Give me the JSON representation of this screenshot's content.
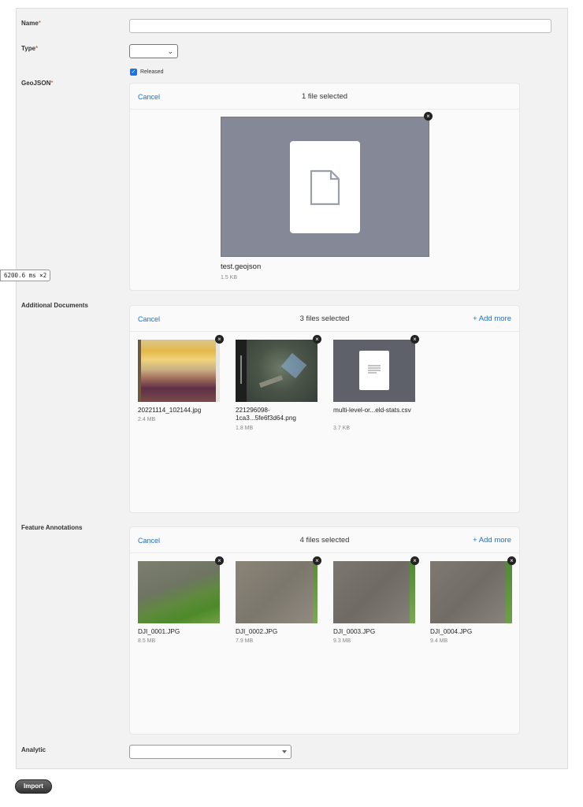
{
  "form": {
    "name": {
      "label": "Name",
      "required_mark": "*",
      "value": ""
    },
    "type": {
      "label": "Type",
      "required_mark": "*",
      "selected": ""
    },
    "released": {
      "label": "Released",
      "checked": true
    },
    "geojson": {
      "label": "GeoJSON",
      "required_mark": "*",
      "cancel": "Cancel",
      "status": "1 file selected",
      "files": [
        {
          "name": "test.geojson",
          "size": "1.5 KB",
          "kind": "document"
        }
      ]
    },
    "additional_documents": {
      "label": "Additional Documents",
      "cancel": "Cancel",
      "status": "3 files selected",
      "add_more": "+ Add more",
      "files": [
        {
          "name": "20221114_102144.jpg",
          "size": "2.4 MB",
          "kind": "painting"
        },
        {
          "name": "221296098-1ca3...5fe6f3d64.png",
          "size": "1.8 MB",
          "kind": "map"
        },
        {
          "name": "multi-level-or...eld-stats.csv",
          "size": "3.7 KB",
          "kind": "document"
        }
      ]
    },
    "feature_annotations": {
      "label": "Feature Annotations",
      "cancel": "Cancel",
      "status": "4 files selected",
      "add_more": "+ Add more",
      "files": [
        {
          "name": "DJI_0001.JPG",
          "size": "8.5 MB",
          "kind": "aerial-green"
        },
        {
          "name": "DJI_0002.JPG",
          "size": "7.9 MB",
          "kind": "aerial-soil"
        },
        {
          "name": "DJI_0003.JPG",
          "size": "9.3 MB",
          "kind": "aerial-soil-edge"
        },
        {
          "name": "DJI_0004.JPG",
          "size": "9.4 MB",
          "kind": "aerial-soil-edge"
        }
      ]
    },
    "analytic": {
      "label": "Analytic",
      "selected": ""
    }
  },
  "import_button": "Import",
  "timing_badge": {
    "value": "6200.6",
    "unit": "ms",
    "multiplier": "×2"
  },
  "colors": {
    "link": "#1f6fc5",
    "panel": "#f2f2f2",
    "preview_bg": "#858896",
    "checkbox": "#1a73e8",
    "required": "#c0392b"
  }
}
